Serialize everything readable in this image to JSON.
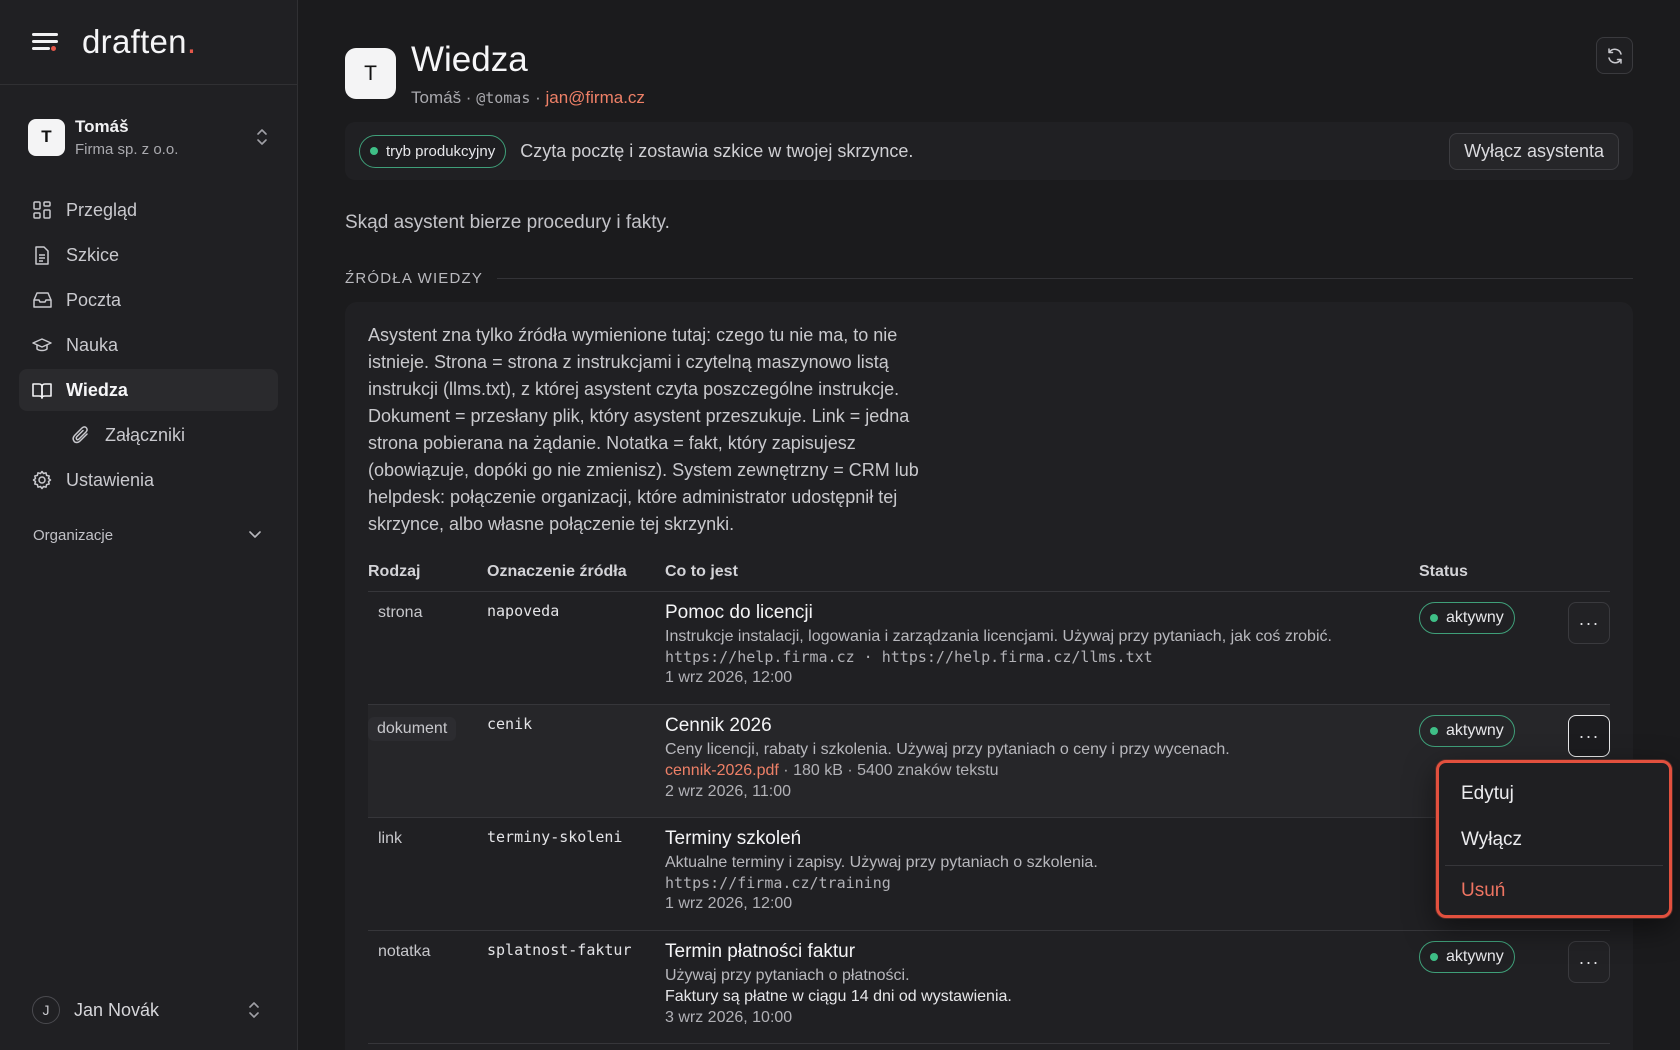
{
  "app": {
    "brand": "draften",
    "brand_dot": "."
  },
  "account": {
    "initial": "T",
    "name": "Tomáš",
    "org": "Firma sp. z o.o."
  },
  "nav": {
    "items": [
      {
        "label": "Przegląd",
        "icon": "grid-icon"
      },
      {
        "label": "Szkice",
        "icon": "document-icon"
      },
      {
        "label": "Poczta",
        "icon": "inbox-icon"
      },
      {
        "label": "Nauka",
        "icon": "graduation-cap-icon"
      },
      {
        "label": "Wiedza",
        "icon": "book-icon",
        "active": true
      },
      {
        "label": "Załączniki",
        "icon": "paperclip-icon",
        "sub": true
      },
      {
        "label": "Ustawienia",
        "icon": "gear-icon"
      }
    ],
    "orgs_label": "Organizacje"
  },
  "user": {
    "initial": "J",
    "name": "Jan Novák"
  },
  "page": {
    "avatar": "T",
    "title": "Wiedza",
    "owner": "Tomáš",
    "sep1": " · ",
    "handle": "@tomas",
    "sep2": " · ",
    "email": "jan@firma.cz"
  },
  "mode": {
    "pill": "tryb produkcyjny",
    "text": "Czyta pocztę i zostawia szkice w twojej skrzynce.",
    "button": "Wyłącz asystenta"
  },
  "lead": "Skąd asystent bierze procedury i fakty.",
  "section_label": "ŹRÓDŁA WIEDZY",
  "intro": "Asystent zna tylko źródła wymienione tutaj: czego tu nie ma, to nie istnieje. Strona = strona z instrukcjami i czytelną maszynowo listą instrukcji (llms.txt), z której asystent czyta poszczególne instrukcje. Dokument = przesłany plik, który asystent przeszukuje. Link = jedna strona pobierana na żądanie. Notatka = fakt, który zapisujesz (obowiązuje, dopóki go nie zmienisz). System zewnętrzny = CRM lub helpdesk: połączenie organizacji, które administrator udostępnił tej skrzynce, albo własne połączenie tej skrzynki.",
  "table": {
    "headers": [
      "Rodzaj",
      "Oznaczenie źródła",
      "Co to jest",
      "Status"
    ],
    "rows": [
      {
        "kind": "strona",
        "id": "napoveda",
        "title": "Pomoc do licencji",
        "desc": "Instrukcje instalacji, logowania i zarządzania licencjami. Używaj przy pytaniach, jak coś zrobić.",
        "urls": "https://help.firma.cz · https://help.firma.cz/llms.txt",
        "date": "1 wrz 2026, 12:00",
        "status": "aktywny"
      },
      {
        "kind": "dokument",
        "id": "cenik",
        "title": "Cennik 2026",
        "desc": "Ceny licencji, rabaty i szkolenia. Używaj przy pytaniach o ceny i przy wycenach.",
        "file": "cennik-2026.pdf",
        "file_meta": " · 180 kB · 5400 znaków tekstu",
        "date": "2 wrz 2026, 11:00",
        "status": "aktywny"
      },
      {
        "kind": "link",
        "id": "terminy-skoleni",
        "title": "Terminy szkoleń",
        "desc": "Aktualne terminy i zapisy. Używaj przy pytaniach o szkolenia.",
        "urls": "https://firma.cz/training",
        "date": "1 wrz 2026, 12:00"
      },
      {
        "kind": "notatka",
        "id": "splatnost-faktur",
        "title": "Termin płatności faktur",
        "desc": "Używaj przy pytaniach o płatności.",
        "fact": "Faktury są płatne w ciągu 14 dni od wystawienia.",
        "date": "3 wrz 2026, 10:00",
        "status": "aktywny"
      }
    ]
  },
  "menu": {
    "edit": "Edytuj",
    "disable": "Wyłącz",
    "delete": "Usuń"
  },
  "colors": {
    "accent": "#ee8067",
    "active_green": "#3fbf87",
    "danger": "#e2503e"
  }
}
